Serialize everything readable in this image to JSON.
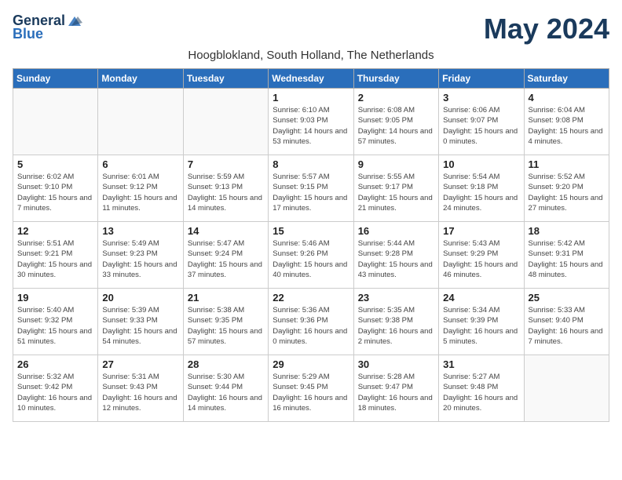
{
  "header": {
    "logo_general": "General",
    "logo_blue": "Blue",
    "month_title": "May 2024",
    "subtitle": "Hoogblokland, South Holland, The Netherlands"
  },
  "weekdays": [
    "Sunday",
    "Monday",
    "Tuesday",
    "Wednesday",
    "Thursday",
    "Friday",
    "Saturday"
  ],
  "weeks": [
    [
      {
        "day": "",
        "info": ""
      },
      {
        "day": "",
        "info": ""
      },
      {
        "day": "",
        "info": ""
      },
      {
        "day": "1",
        "info": "Sunrise: 6:10 AM\nSunset: 9:03 PM\nDaylight: 14 hours and 53 minutes."
      },
      {
        "day": "2",
        "info": "Sunrise: 6:08 AM\nSunset: 9:05 PM\nDaylight: 14 hours and 57 minutes."
      },
      {
        "day": "3",
        "info": "Sunrise: 6:06 AM\nSunset: 9:07 PM\nDaylight: 15 hours and 0 minutes."
      },
      {
        "day": "4",
        "info": "Sunrise: 6:04 AM\nSunset: 9:08 PM\nDaylight: 15 hours and 4 minutes."
      }
    ],
    [
      {
        "day": "5",
        "info": "Sunrise: 6:02 AM\nSunset: 9:10 PM\nDaylight: 15 hours and 7 minutes."
      },
      {
        "day": "6",
        "info": "Sunrise: 6:01 AM\nSunset: 9:12 PM\nDaylight: 15 hours and 11 minutes."
      },
      {
        "day": "7",
        "info": "Sunrise: 5:59 AM\nSunset: 9:13 PM\nDaylight: 15 hours and 14 minutes."
      },
      {
        "day": "8",
        "info": "Sunrise: 5:57 AM\nSunset: 9:15 PM\nDaylight: 15 hours and 17 minutes."
      },
      {
        "day": "9",
        "info": "Sunrise: 5:55 AM\nSunset: 9:17 PM\nDaylight: 15 hours and 21 minutes."
      },
      {
        "day": "10",
        "info": "Sunrise: 5:54 AM\nSunset: 9:18 PM\nDaylight: 15 hours and 24 minutes."
      },
      {
        "day": "11",
        "info": "Sunrise: 5:52 AM\nSunset: 9:20 PM\nDaylight: 15 hours and 27 minutes."
      }
    ],
    [
      {
        "day": "12",
        "info": "Sunrise: 5:51 AM\nSunset: 9:21 PM\nDaylight: 15 hours and 30 minutes."
      },
      {
        "day": "13",
        "info": "Sunrise: 5:49 AM\nSunset: 9:23 PM\nDaylight: 15 hours and 33 minutes."
      },
      {
        "day": "14",
        "info": "Sunrise: 5:47 AM\nSunset: 9:24 PM\nDaylight: 15 hours and 37 minutes."
      },
      {
        "day": "15",
        "info": "Sunrise: 5:46 AM\nSunset: 9:26 PM\nDaylight: 15 hours and 40 minutes."
      },
      {
        "day": "16",
        "info": "Sunrise: 5:44 AM\nSunset: 9:28 PM\nDaylight: 15 hours and 43 minutes."
      },
      {
        "day": "17",
        "info": "Sunrise: 5:43 AM\nSunset: 9:29 PM\nDaylight: 15 hours and 46 minutes."
      },
      {
        "day": "18",
        "info": "Sunrise: 5:42 AM\nSunset: 9:31 PM\nDaylight: 15 hours and 48 minutes."
      }
    ],
    [
      {
        "day": "19",
        "info": "Sunrise: 5:40 AM\nSunset: 9:32 PM\nDaylight: 15 hours and 51 minutes."
      },
      {
        "day": "20",
        "info": "Sunrise: 5:39 AM\nSunset: 9:33 PM\nDaylight: 15 hours and 54 minutes."
      },
      {
        "day": "21",
        "info": "Sunrise: 5:38 AM\nSunset: 9:35 PM\nDaylight: 15 hours and 57 minutes."
      },
      {
        "day": "22",
        "info": "Sunrise: 5:36 AM\nSunset: 9:36 PM\nDaylight: 16 hours and 0 minutes."
      },
      {
        "day": "23",
        "info": "Sunrise: 5:35 AM\nSunset: 9:38 PM\nDaylight: 16 hours and 2 minutes."
      },
      {
        "day": "24",
        "info": "Sunrise: 5:34 AM\nSunset: 9:39 PM\nDaylight: 16 hours and 5 minutes."
      },
      {
        "day": "25",
        "info": "Sunrise: 5:33 AM\nSunset: 9:40 PM\nDaylight: 16 hours and 7 minutes."
      }
    ],
    [
      {
        "day": "26",
        "info": "Sunrise: 5:32 AM\nSunset: 9:42 PM\nDaylight: 16 hours and 10 minutes."
      },
      {
        "day": "27",
        "info": "Sunrise: 5:31 AM\nSunset: 9:43 PM\nDaylight: 16 hours and 12 minutes."
      },
      {
        "day": "28",
        "info": "Sunrise: 5:30 AM\nSunset: 9:44 PM\nDaylight: 16 hours and 14 minutes."
      },
      {
        "day": "29",
        "info": "Sunrise: 5:29 AM\nSunset: 9:45 PM\nDaylight: 16 hours and 16 minutes."
      },
      {
        "day": "30",
        "info": "Sunrise: 5:28 AM\nSunset: 9:47 PM\nDaylight: 16 hours and 18 minutes."
      },
      {
        "day": "31",
        "info": "Sunrise: 5:27 AM\nSunset: 9:48 PM\nDaylight: 16 hours and 20 minutes."
      },
      {
        "day": "",
        "info": ""
      }
    ]
  ]
}
